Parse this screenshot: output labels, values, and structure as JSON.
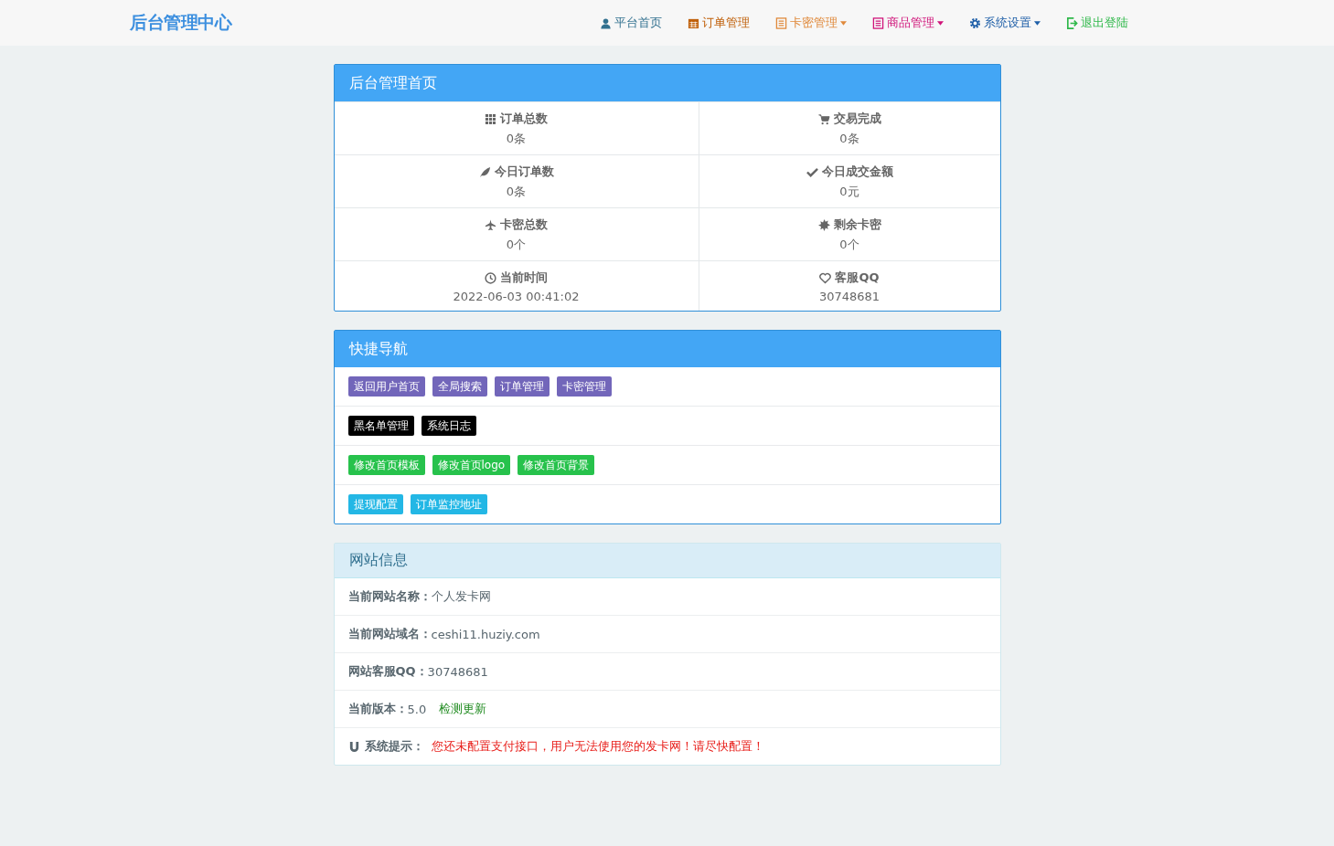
{
  "brand": "后台管理中心",
  "nav": [
    {
      "label": "平台首页",
      "color": "#31708f",
      "dropdown": false
    },
    {
      "label": "订单管理",
      "color": "#c0600a",
      "dropdown": false
    },
    {
      "label": "卡密管理",
      "color": "#e08a3c",
      "dropdown": true
    },
    {
      "label": "商品管理",
      "color": "#d0147a",
      "dropdown": true
    },
    {
      "label": "系统设置",
      "color": "#1f5fa8",
      "dropdown": true
    },
    {
      "label": "退出登陆",
      "color": "#2fb84a",
      "dropdown": false
    }
  ],
  "stats_panel": {
    "title": "后台管理首页",
    "rows": [
      [
        {
          "label": "订单总数",
          "value": "0条"
        },
        {
          "label": "交易完成",
          "value": "0条"
        }
      ],
      [
        {
          "label": "今日订单数",
          "value": "0条"
        },
        {
          "label": "今日成交金额",
          "value": "0元"
        }
      ],
      [
        {
          "label": "卡密总数",
          "value": "0个"
        },
        {
          "label": "剩余卡密",
          "value": "0个"
        }
      ],
      [
        {
          "label": "当前时间",
          "value": "2022-06-03 00:41:02"
        },
        {
          "label": "客服QQ",
          "value": "30748681"
        }
      ]
    ]
  },
  "quick_nav": {
    "title": "快捷导航",
    "rows": [
      [
        {
          "label": "返回用户首页",
          "color": "#7266ba"
        },
        {
          "label": "全局搜索",
          "color": "#7266ba"
        },
        {
          "label": "订单管理",
          "color": "#7266ba"
        },
        {
          "label": "卡密管理",
          "color": "#7266ba"
        }
      ],
      [
        {
          "label": "黑名单管理",
          "color": "#000000"
        },
        {
          "label": "系统日志",
          "color": "#000000"
        }
      ],
      [
        {
          "label": "修改首页模板",
          "color": "#27c24c"
        },
        {
          "label": "修改首页logo",
          "color": "#27c24c"
        },
        {
          "label": "修改首页背景",
          "color": "#27c24c"
        }
      ],
      [
        {
          "label": "提现配置",
          "color": "#23b7e5"
        },
        {
          "label": "订单监控地址",
          "color": "#23b7e5"
        }
      ]
    ]
  },
  "site_info": {
    "title": "网站信息",
    "items": [
      {
        "kind": "field",
        "label": "当前网站名称：",
        "value": "个人发卡网"
      },
      {
        "kind": "field",
        "label": "当前网站域名：",
        "value": "ceshi11.huziy.com"
      },
      {
        "kind": "field",
        "label": "网站客服QQ：",
        "value": "30748681"
      },
      {
        "kind": "version",
        "label": "当前版本：",
        "value": "5.0",
        "link": "检测更新"
      },
      {
        "kind": "notice",
        "label": "系统提示：",
        "value": "您还未配置支付接口，用户无法使用您的发卡网！请尽快配置！"
      }
    ]
  }
}
